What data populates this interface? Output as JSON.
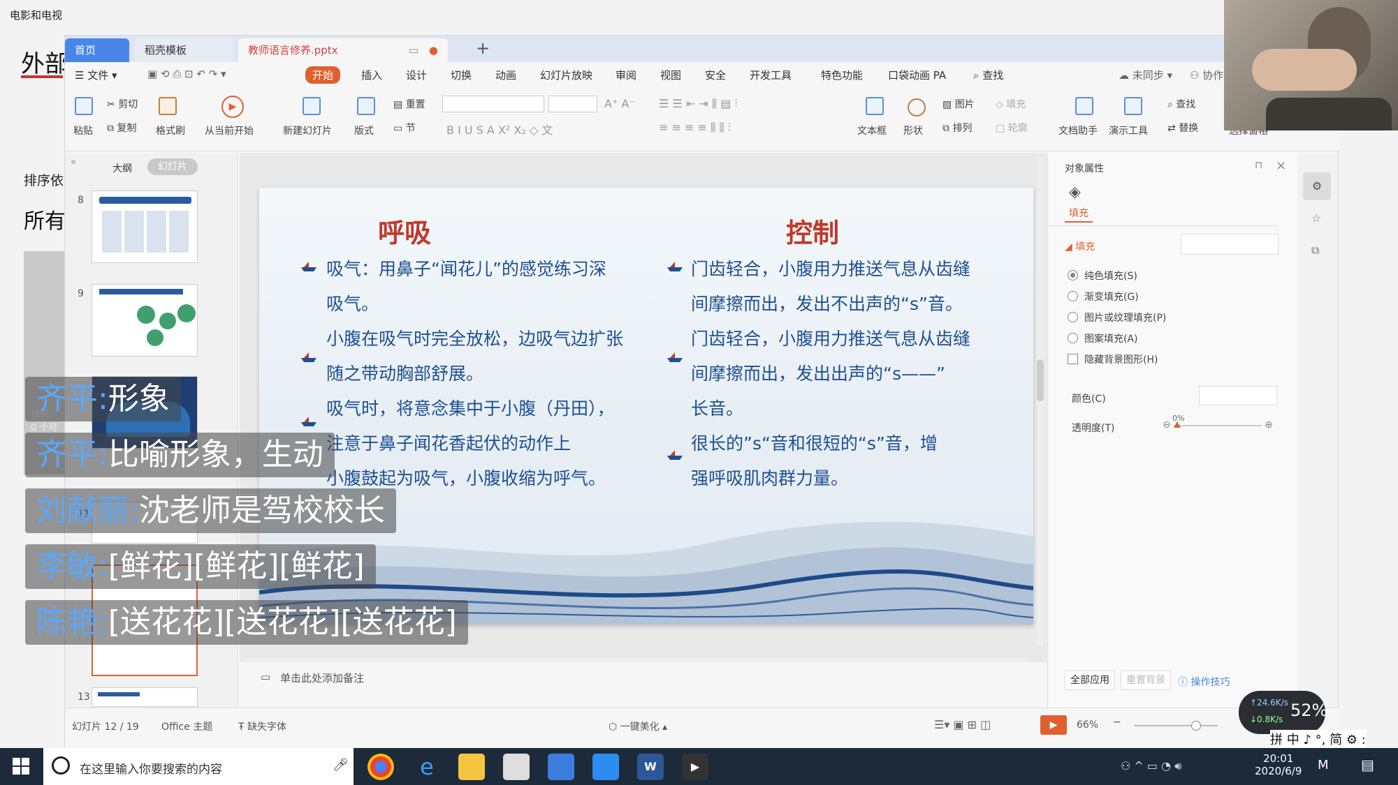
{
  "bg_app": {
    "title": "电影和电视",
    "heading": "外部",
    "sort_label": "排序依",
    "all_label": "所有",
    "overlay": "找机",
    "overlay2": "0 个可"
  },
  "tabs": {
    "home": "首页",
    "template": "稻壳模板",
    "doc": "教师语言修养.pptx"
  },
  "menu": {
    "file": "文件",
    "items": [
      "开始",
      "插入",
      "设计",
      "切换",
      "动画",
      "幻灯片放映",
      "审阅",
      "视图",
      "安全",
      "开发工具",
      "特色功能",
      "口袋动画 PA"
    ],
    "search": "查找",
    "sync": "未同步",
    "collab": "协作"
  },
  "ribbon": {
    "paste": "粘贴",
    "cut": "剪切",
    "copy": "复制",
    "format_painter": "格式刷",
    "play_from_current": "从当前开始",
    "new_slide": "新建幻灯片",
    "layout": "版式",
    "reset": "重置",
    "section": "节",
    "textbox": "文本框",
    "shape": "形状",
    "arrange": "排列",
    "picture": "图片",
    "fill": "填充",
    "outline": "轮廓",
    "doc_assistant": "文档助手",
    "present_tools": "演示工具",
    "find": "查找",
    "replace": "替换",
    "select_pane": "选择窗格"
  },
  "left_pane": {
    "outline_tab": "大纲",
    "slides_tab": "幻灯片",
    "slide_numbers": [
      "8",
      "9",
      "11",
      "13"
    ]
  },
  "slide": {
    "left_title": "呼吸",
    "right_title": "控制",
    "left_items": [
      "吸气：用鼻子“闻花儿”的感觉练习深",
      "吸气。",
      "小腹在吸气时完全放松，边吸气边扩张",
      "随之带动胸部舒展。",
      "吸气时，将意念集中于小腹（丹田），",
      "注意于鼻子闻花香起伏的动作上",
      "小腹鼓起为吸气，小腹收缩为呼气。"
    ],
    "right_items": [
      "门齿轻合，小腹用力推送气息从齿缝",
      "间摩擦而出，发出不出声的“s”音。",
      "门齿轻合，小腹用力推送气息从齿缝",
      "间摩擦而出，发出出声的“s——”",
      "长音。",
      "很长的”s“音和很短的“s”音，增",
      "强呼吸肌肉群力量。"
    ]
  },
  "notes_placeholder": "单击此处添加备注",
  "right_panel": {
    "title": "对象属性",
    "fill_tab": "填充",
    "fill_section": "填充",
    "options": [
      "纯色填充(S)",
      "渐变填充(G)",
      "图片或纹理填充(P)",
      "图案填充(A)"
    ],
    "hide_bg": "隐藏背景图形(H)",
    "color_label": "颜色(C)",
    "transparency_label": "透明度(T)",
    "transparency_value": "0%",
    "apply_all": "全部应用",
    "reset_bg": "重置背景",
    "tips": "操作技巧"
  },
  "statusbar": {
    "slide_count": "幻灯片 12 / 19",
    "theme": "Office 主题",
    "missing_font": "缺失字体",
    "beautify": "一键美化",
    "zoom": "66%"
  },
  "chat": [
    {
      "name": "齐平:",
      "text": "形象"
    },
    {
      "name": "齐平:",
      "text": "比喻形象，生动"
    },
    {
      "name": "刘献丽:",
      "text": "沈老师是驾校校长"
    },
    {
      "name": "李敏:",
      "text": "[鲜花][鲜花][鲜花]"
    },
    {
      "name": "陈艳:",
      "text": "[送花花][送花花][送花花]"
    }
  ],
  "speed_widget": {
    "up": "↑24.6K/s",
    "down": "↓0.8K/s",
    "percent": "52%"
  },
  "ime": "拼 中 ♪ °, 简 ⚙ :",
  "taskbar": {
    "search_placeholder": "在这里输入你要搜索的内容",
    "time": "20:01",
    "date": "2020/6/9"
  }
}
